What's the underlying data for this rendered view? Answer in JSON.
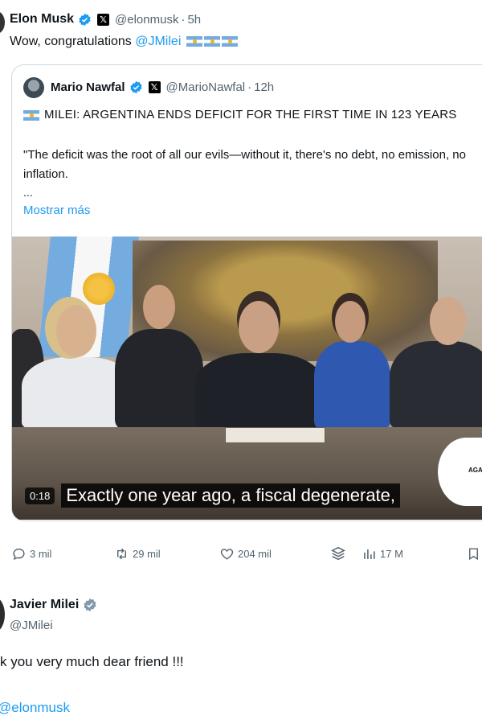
{
  "top_tweet": {
    "name": "Elon Musk",
    "handle": "@elonmusk",
    "separator": "·",
    "time": "5h",
    "text": "Wow, congratulations ",
    "mention": "@JMilei",
    "flag_count": 3
  },
  "quote": {
    "name": "Mario Nawfal",
    "handle": "@MarioNawfal",
    "separator": "·",
    "time": "12h",
    "headline": "MILEI: ARGENTINA ENDS DEFICIT FOR THE FIRST TIME IN 123 YEARS",
    "body": "\"The deficit was the root of all our evils—without it, there's no debt, no emission, no inflation.",
    "ellipsis": "...",
    "show_more": "Mostrar más",
    "video": {
      "timecode": "0:18",
      "caption": "Exactly one year ago, a fiscal degenerate,",
      "logo_text": "AGARR"
    }
  },
  "actions": {
    "replies": "3 mil",
    "reposts": "29 mil",
    "likes": "204 mil",
    "views": "17 M"
  },
  "reply": {
    "name": "Javier Milei",
    "handle": "@JMilei",
    "text": "k you very much dear friend !!!",
    "mention": "@elonmusk"
  },
  "colors": {
    "accent": "#1d9bf0",
    "secondary_text": "#536471",
    "verified_blue": "#1d9bf0",
    "verified_gray": "#829aab"
  }
}
